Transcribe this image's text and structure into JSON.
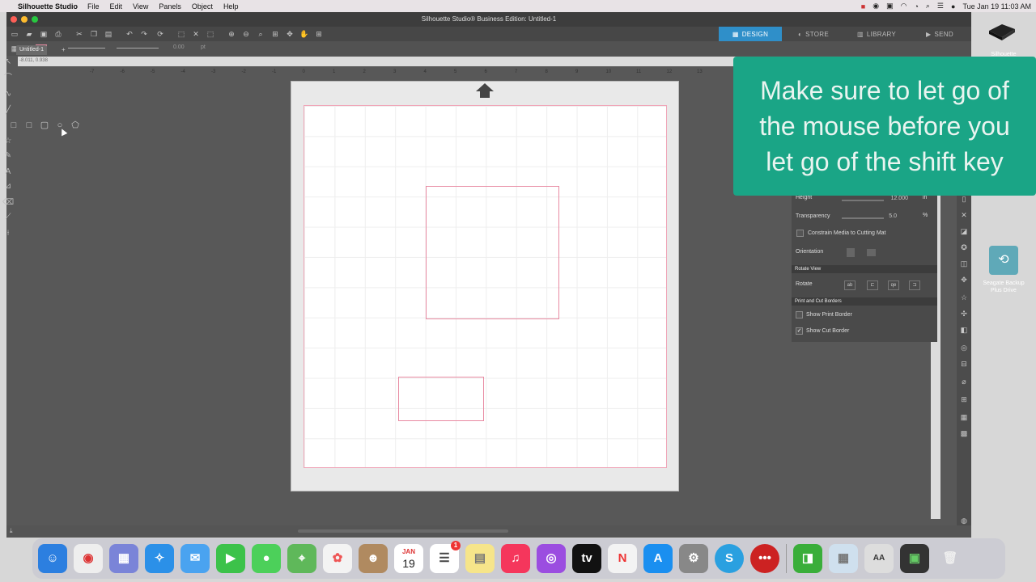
{
  "menubar": {
    "app_name": "Silhouette Studio",
    "menus": [
      "File",
      "Edit",
      "View",
      "Panels",
      "Object",
      "Help"
    ],
    "clock": "Tue Jan 19  11:03 AM"
  },
  "window": {
    "title": "Silhouette Studio® Business Edition: Untitled-1",
    "doc_tab": "Untitled-1",
    "doc_tab_add": "+",
    "coord_readout": "-8.011, 0.938"
  },
  "tabs": [
    {
      "icon": "design-icon",
      "label": "DESIGN"
    },
    {
      "icon": "store-icon",
      "label": "STORE"
    },
    {
      "icon": "library-icon",
      "label": "LIBRARY"
    },
    {
      "icon": "send-icon",
      "label": "SEND"
    }
  ],
  "line_controls": {
    "thickness": "0.00",
    "unit": "pt"
  },
  "ruler_top_labels": [
    "-7",
    "-6",
    "-5",
    "-4",
    "-3",
    "-2",
    "-1",
    "0",
    "1",
    "2",
    "3",
    "4",
    "5",
    "6",
    "7",
    "8",
    "9",
    "10",
    "11",
    "12",
    "13"
  ],
  "panel": {
    "height_label": "Height",
    "height_value": "12.000",
    "height_unit": "in",
    "transparency_label": "Transparency",
    "transparency_value": "5.0",
    "transparency_unit": "%",
    "constrain_label": "Constrain Media to Cutting Mat",
    "orientation_label": "Orientation",
    "rotate_view_section": "Rotate View",
    "rotate_label": "Rotate",
    "print_cut_section": "Print and Cut Borders",
    "show_print_border": "Show Print Border",
    "show_cut_border": "Show Cut Border",
    "show_cut_border_checked": true
  },
  "overlay": {
    "line1": "Make sure to let go of",
    "line2": "the mouse before you",
    "line3": "let go of the shift key"
  },
  "desktop": {
    "silhouette_label": "Silhouette",
    "seagate_label_1": "Seagate Backup",
    "seagate_label_2": "Plus Drive"
  },
  "dock": {
    "calendar_month": "JAN",
    "calendar_day": "19",
    "badge": "1"
  },
  "colors": {
    "accent": "#2f8fc9",
    "overlay": "#1aa586",
    "cut_line": "#e88aa2"
  }
}
